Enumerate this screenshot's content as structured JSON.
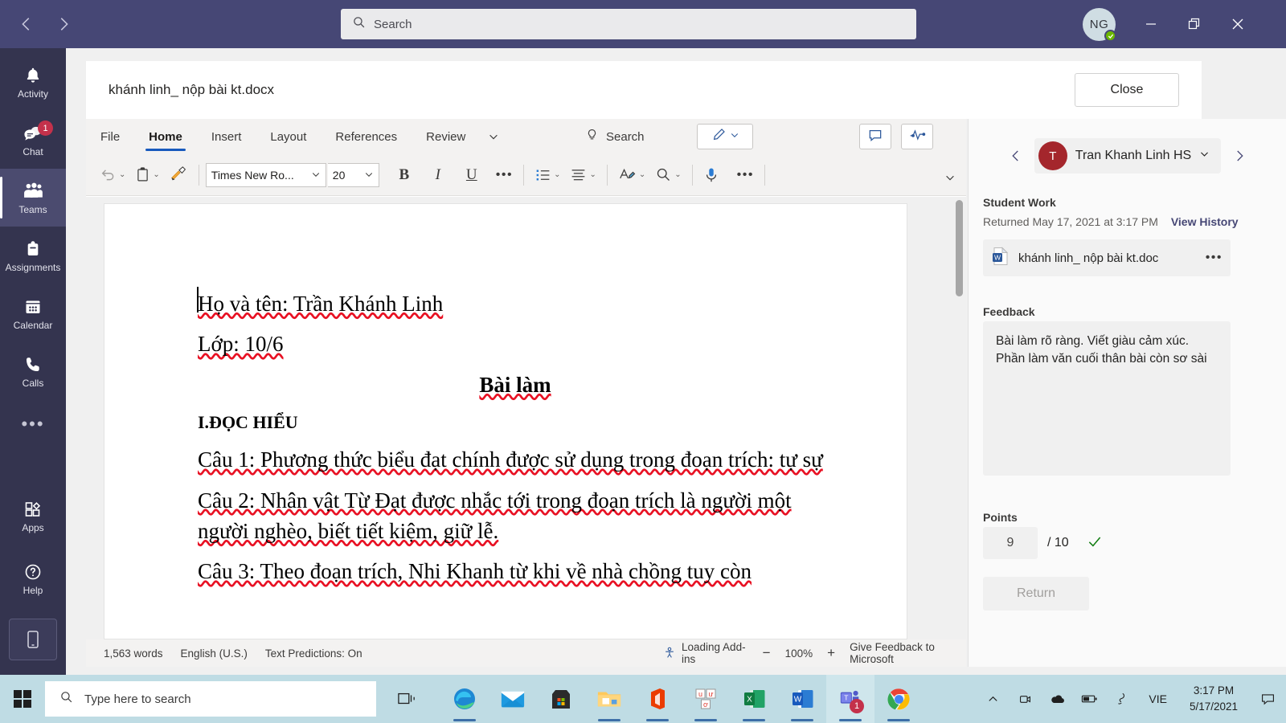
{
  "titlebar": {
    "back_icon": "chevron-left-icon",
    "forward_icon": "chevron-right-icon",
    "search_placeholder": "Search",
    "avatar_initials": "NG",
    "minimize_label": "—",
    "maximize_label": "❐",
    "close_label": "✕"
  },
  "rail": {
    "items": [
      {
        "label": "Activity",
        "icon": "bell-icon",
        "badge": ""
      },
      {
        "label": "Chat",
        "icon": "chat-icon",
        "badge": "1"
      },
      {
        "label": "Teams",
        "icon": "teams-icon",
        "badge": ""
      },
      {
        "label": "Assignments",
        "icon": "assignments-icon",
        "badge": ""
      },
      {
        "label": "Calendar",
        "icon": "calendar-icon",
        "badge": ""
      },
      {
        "label": "Calls",
        "icon": "phone-icon",
        "badge": ""
      }
    ],
    "more_label": "•••",
    "bottom_items": [
      {
        "label": "Apps",
        "icon": "apps-icon"
      },
      {
        "label": "Help",
        "icon": "help-icon"
      }
    ],
    "mobile_icon": "mobile-phone-icon"
  },
  "doc_header": {
    "title": "khánh linh_ nộp bài kt.docx",
    "close_label": "Close"
  },
  "word": {
    "tabs": [
      {
        "label": "File",
        "active": false
      },
      {
        "label": "Home",
        "active": true
      },
      {
        "label": "Insert",
        "active": false
      },
      {
        "label": "Layout",
        "active": false
      },
      {
        "label": "References",
        "active": false
      },
      {
        "label": "Review",
        "active": false
      }
    ],
    "tab_overflow_icon": "chevron-down-icon",
    "search_label": "Search",
    "search_icon": "lightbulb-icon",
    "pen_icon": "pen-icon",
    "comments_icon": "comment-icon",
    "editing_icon": "activity-line-icon",
    "toolbar": {
      "undo_icon": "undo-icon",
      "paste_icon": "paste-icon",
      "format_painter_icon": "format-painter-icon",
      "font_name": "Times New Ro...",
      "font_size": "20",
      "bold_label": "B",
      "italic_label": "I",
      "underline_label": "U",
      "more_font_label": "•••",
      "bullets_icon": "bullet-list-icon",
      "align_icon": "align-icon",
      "styles_icon": "text-styles-icon",
      "find_icon": "search-icon",
      "dictate_icon": "microphone-icon",
      "more_label": "•••",
      "collapse_icon": "chevron-down-icon"
    },
    "document": {
      "lines": [
        {
          "text": "Họ và tên: Trần Khánh Linh",
          "style": "normal"
        },
        {
          "text": "Lớp: 10/6",
          "style": "normal"
        },
        {
          "text": "Bài làm",
          "style": "centered"
        },
        {
          "text": "I.ĐỌC HIỂU",
          "style": "heading-bold"
        },
        {
          "text": "Câu 1: Phương thức biểu đạt chính được sử dụng trong đoạn trích: tự sự",
          "style": "normal"
        },
        {
          "text": "Câu 2: Nhân vật Từ Đạt được nhắc tới trong đoạn trích là người một người nghèo, biết tiết kiệm, giữ lễ.",
          "style": "normal"
        },
        {
          "text": "Câu 3: Theo đoạn trích, Nhi Khanh từ khi về nhà chồng tuy còn",
          "style": "normal"
        }
      ]
    },
    "status": {
      "word_count": "1,563 words",
      "language": "English (U.S.)",
      "predictions": "Text Predictions: On",
      "addins": "Loading Add-ins",
      "addins_icon": "accessibility-icon",
      "zoom_out": "−",
      "zoom_level": "100%",
      "zoom_in": "+",
      "feedback": "Give Feedback to Microsoft"
    }
  },
  "grading": {
    "prev_icon": "chevron-left-icon",
    "next_icon": "chevron-right-icon",
    "student_initial": "T",
    "student_name": "Tran Khanh Linh HS",
    "student_chevron": "chevron-down-icon",
    "student_work_label": "Student Work",
    "returned_text": "Returned May 17, 2021 at 3:17 PM",
    "view_history_label": "View History",
    "attachment_name": "khánh linh_ nộp bài kt.doc",
    "attachment_icon": "word-doc-icon",
    "attachment_more": "•••",
    "feedback_label": "Feedback",
    "feedback_text": "Bài làm rõ ràng. Viết giàu cảm xúc. Phần làm văn cuối thân bài còn sơ sài",
    "points_label": "Points",
    "points_value": "9",
    "points_total": "/ 10",
    "points_check_icon": "checkmark-icon",
    "return_label": "Return"
  },
  "taskbar": {
    "start_icon": "windows-start-icon",
    "search_placeholder": "Type here to search",
    "search_icon": "search-icon",
    "task_view_icon": "task-view-icon",
    "apps": [
      {
        "name": "edge-icon",
        "running": true,
        "active": false,
        "badge": ""
      },
      {
        "name": "mail-icon",
        "running": false,
        "active": false,
        "badge": ""
      },
      {
        "name": "microsoft-store-icon",
        "running": false,
        "active": false,
        "badge": ""
      },
      {
        "name": "file-explorer-icon",
        "running": true,
        "active": false,
        "badge": ""
      },
      {
        "name": "office-icon",
        "running": true,
        "active": false,
        "badge": ""
      },
      {
        "name": "unikey-icon",
        "running": true,
        "active": false,
        "badge": ""
      },
      {
        "name": "excel-icon",
        "running": true,
        "active": false,
        "badge": ""
      },
      {
        "name": "word-icon",
        "running": true,
        "active": false,
        "badge": ""
      },
      {
        "name": "teams-icon",
        "running": true,
        "active": true,
        "badge": "1"
      },
      {
        "name": "chrome-icon",
        "running": true,
        "active": false,
        "badge": ""
      }
    ],
    "tray": {
      "show_hidden_icon": "chevron-up-icon",
      "camera_icon": "camera-icon",
      "onedrive_icon": "onedrive-icon",
      "battery_icon": "battery-icon",
      "pen_icon": "pen-tray-icon",
      "language": "VIE",
      "time": "3:17 PM",
      "date": "5/17/2021",
      "notification_icon": "notification-icon"
    }
  },
  "colors": {
    "teams_purple": "#464775",
    "rail_dark": "#34344f",
    "badge_red": "#c4314b",
    "word_blue": "#185abd",
    "accent_link": "#464775",
    "check_green": "#107c10",
    "avatar_red": "#a4262c",
    "taskbar": "#bfdce4"
  }
}
